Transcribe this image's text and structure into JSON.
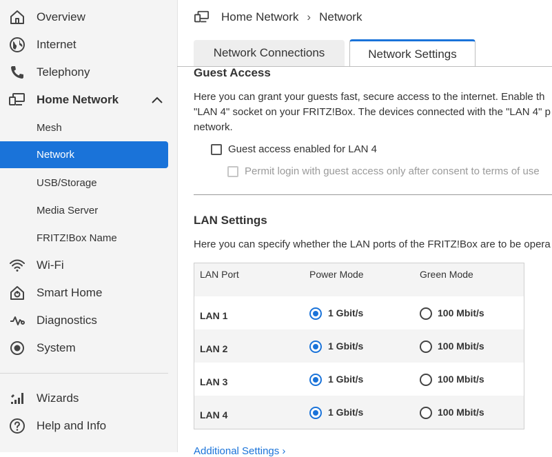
{
  "sidebar": {
    "items": [
      {
        "label": "Overview",
        "icon": "home-icon"
      },
      {
        "label": "Internet",
        "icon": "globe-icon"
      },
      {
        "label": "Telephony",
        "icon": "phone-icon"
      },
      {
        "label": "Home Network",
        "icon": "monitor-network-icon"
      },
      {
        "label": "Wi-Fi",
        "icon": "wifi-icon"
      },
      {
        "label": "Smart Home",
        "icon": "smart-home-icon"
      },
      {
        "label": "Diagnostics",
        "icon": "diagnostics-icon"
      },
      {
        "label": "System",
        "icon": "system-icon"
      },
      {
        "label": "Wizards",
        "icon": "wizard-icon"
      },
      {
        "label": "Help and Info",
        "icon": "help-icon"
      }
    ],
    "sub_items": [
      {
        "label": "Mesh"
      },
      {
        "label": "Network",
        "active": true
      },
      {
        "label": "USB/Storage"
      },
      {
        "label": "Media Server"
      },
      {
        "label": "FRITZ!Box Name"
      }
    ]
  },
  "header": {
    "breadcrumb": [
      "Home Network",
      "Network"
    ],
    "separator": "›"
  },
  "tabs": [
    {
      "label": "Network Connections",
      "active": false
    },
    {
      "label": "Network Settings",
      "active": true
    }
  ],
  "guest": {
    "title": "Guest Access",
    "text_lines": [
      "Here you can grant your guests fast, secure access to the internet. Enable th",
      "\"LAN 4\" socket on your FRITZ!Box. The devices connected with the \"LAN 4\" p",
      "network."
    ],
    "checkbox_lan4": {
      "label": "Guest access enabled for LAN 4",
      "checked": false
    },
    "checkbox_terms": {
      "label": "Permit login with guest access only after consent to terms of use",
      "checked": false,
      "disabled": true
    }
  },
  "lan": {
    "title": "LAN Settings",
    "text": "Here you can specify whether the LAN ports of the FRITZ!Box are to be opera",
    "columns": [
      "LAN Port",
      "Power Mode",
      "Green Mode"
    ],
    "power_label": "1 Gbit/s",
    "green_label": "100 Mbit/s",
    "rows": [
      {
        "port": "LAN 1",
        "mode": "power"
      },
      {
        "port": "LAN 2",
        "mode": "power"
      },
      {
        "port": "LAN 3",
        "mode": "power"
      },
      {
        "port": "LAN 4",
        "mode": "power"
      }
    ]
  },
  "links": {
    "additional": "Additional Settings ›"
  },
  "colors": {
    "accent": "#1a73d9",
    "sidebar_bg": "#f4f4f4"
  }
}
